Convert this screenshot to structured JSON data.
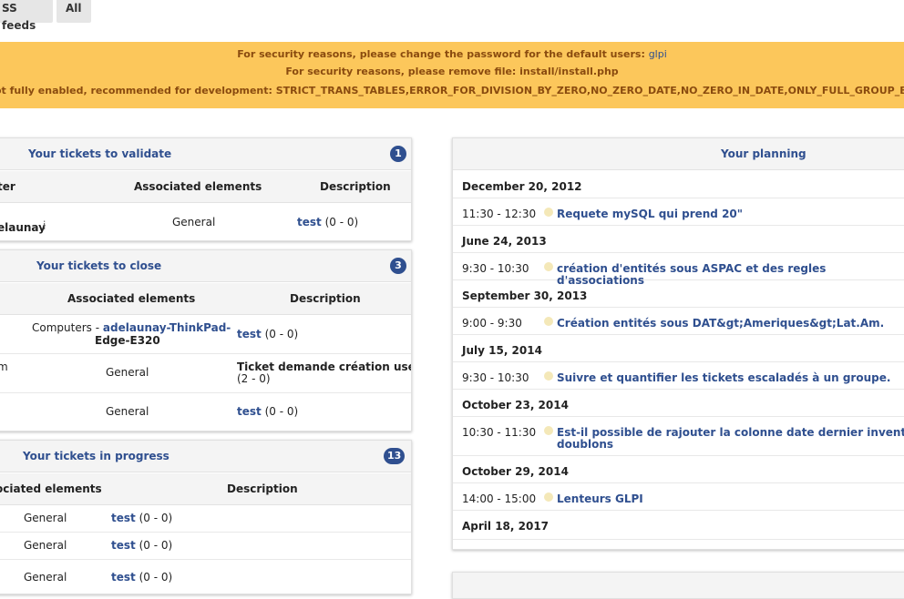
{
  "tabs": [
    "SS feeds",
    "All"
  ],
  "banner": {
    "line1_text": "For security reasons, please change the password for the default users: ",
    "line1_link": "glpi",
    "line2": "For security reasons, please remove file: install/install.php",
    "line3": "ot fully enabled, recommended for development: STRICT_TRANS_TABLES,ERROR_FOR_DIVISION_BY_ZERO,NO_ZERO_DATE,NO_ZERO_IN_DATE,ONLY_FULL_GROUP_BY,N"
  },
  "validate": {
    "title": "Your tickets to validate",
    "count": "1",
    "headers": [
      "ter",
      "Associated elements",
      "Description"
    ],
    "rows": [
      {
        "requester": "elaunay",
        "info": "i",
        "elements": "General",
        "desc": "test",
        "desc_count": "(0 - 0)"
      }
    ]
  },
  "close": {
    "title": "Your tickets to close",
    "count": "3",
    "headers": [
      "Associated elements",
      "Description"
    ],
    "rows": [
      {
        "prefix": "",
        "elements_text": "Computers - ",
        "elements_link1": "adelaunay-ThinkPad-",
        "elements_link2": "Edge-E320",
        "desc": "test",
        "desc_count": "(0 - 0)"
      },
      {
        "prefix": "m",
        "elements_text": "General",
        "desc": "Ticket demande création user",
        "desc_count": "(2 - 0)"
      },
      {
        "prefix": "",
        "elements_text": "General",
        "desc": "test",
        "desc_count": "(0 - 0)"
      }
    ]
  },
  "progress": {
    "title": "Your tickets in progress",
    "count": "13",
    "headers": [
      "ociated elements",
      "Description"
    ],
    "rows": [
      {
        "elements": "General",
        "desc": "test",
        "desc_count": "(0 - 0)"
      },
      {
        "elements": "General",
        "desc": "test",
        "desc_count": "(0 - 0)"
      },
      {
        "elements": "General",
        "desc": "test",
        "desc_count": "(0 - 0)"
      }
    ]
  },
  "planning": {
    "title": "Your planning",
    "days": [
      {
        "date": "December 20, 2012",
        "time": "11:30 - 12:30",
        "event": "Requete mySQL qui prend 20\""
      },
      {
        "date": "June 24, 2013",
        "time": "9:30 - 10:30",
        "event": "création d'entités sous ASPAC et des regles d'associations"
      },
      {
        "date": "September 30, 2013",
        "time": "9:00 - 9:30",
        "event": "Création entités sous DAT&gt;Ameriques&gt;Lat.Am."
      },
      {
        "date": "July 15, 2014",
        "time": "9:30 - 10:30",
        "event": "Suivre et quantifier les tickets escaladés à un groupe."
      },
      {
        "date": "October 23, 2014",
        "time": "10:30 - 11:30",
        "event": "Est-il possible de rajouter la colonne date dernier inventaire F",
        "event2": "doublons"
      },
      {
        "date": "October 29, 2014",
        "time": "14:00 - 15:00",
        "event": "Lenteurs GLPI"
      },
      {
        "date": "April 18, 2017"
      }
    ]
  }
}
